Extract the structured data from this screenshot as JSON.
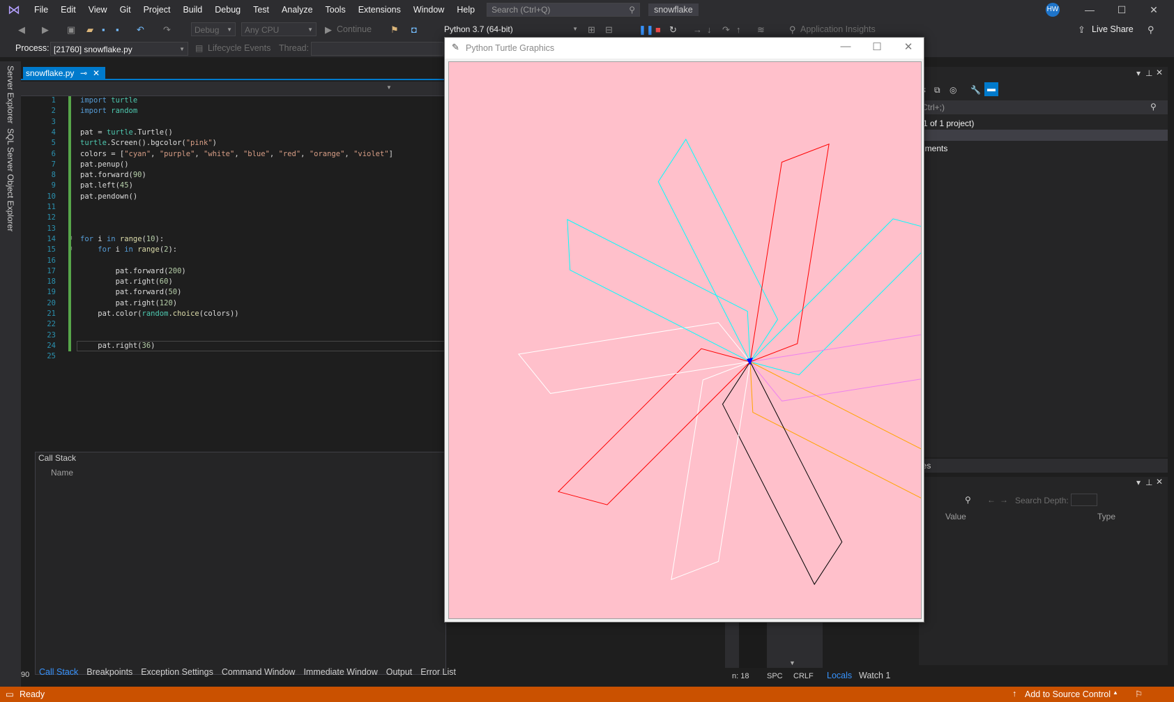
{
  "menubar": {
    "items": [
      "File",
      "Edit",
      "View",
      "Git",
      "Project",
      "Build",
      "Debug",
      "Test",
      "Analyze",
      "Tools",
      "Extensions",
      "Window",
      "Help"
    ],
    "search_placeholder": "Search (Ctrl+Q)",
    "solution_name": "snowflake",
    "user_initials": "HW"
  },
  "toolbar": {
    "config": "Debug",
    "platform": "Any CPU",
    "continue_label": "Continue",
    "python_env": "Python 3.7 (64-bit)",
    "app_insights": "Application Insights",
    "live_share": "Live Share"
  },
  "debugbar": {
    "process_label": "Process:",
    "process_value": "[21760] snowflake.py",
    "lifecycle_label": "Lifecycle Events",
    "thread_label": "Thread:"
  },
  "side_tabs": [
    "Server Explorer",
    "SQL Server Object Explorer"
  ],
  "editor": {
    "tab_name": "snowflake.py",
    "line_numbers": [
      "1",
      "2",
      "3",
      "4",
      "5",
      "6",
      "7",
      "8",
      "9",
      "10",
      "11",
      "12",
      "13",
      "14",
      "15",
      "16",
      "17",
      "18",
      "19",
      "20",
      "21",
      "22",
      "23",
      "24",
      "25"
    ],
    "lines": [
      "import turtle",
      "import random",
      "",
      "pat = turtle.Turtle()",
      "turtle.Screen().bgcolor(\"pink\")",
      "colors = [\"cyan\", \"purple\", \"white\", \"blue\", \"red\", \"orange\", \"violet\"]",
      "pat.penup()",
      "pat.forward(90)",
      "pat.left(45)",
      "pat.pendown()",
      "",
      "",
      "",
      "for i in range(10):",
      "    for i in range(2):",
      "",
      "        pat.forward(200)",
      "        pat.right(60)",
      "        pat.forward(50)",
      "        pat.right(120)",
      "    pat.color(random.choice(colors))",
      "",
      "",
      "    pat.right(36)",
      ""
    ],
    "zoom": "90"
  },
  "callstack": {
    "title": "Call Stack",
    "column_name": "Name"
  },
  "bottom_tabs": [
    "Call Stack",
    "Breakpoints",
    "Exception Settings",
    "Command Window",
    "Immediate Window",
    "Output",
    "Error List"
  ],
  "solution_panel": {
    "search_hint": "Ctrl+;)",
    "solution_line": "(1 of 1 project)",
    "env_line": "nments"
  },
  "properties_title": "ies",
  "locals": {
    "search_depth_label": "Search Depth:",
    "col_value": "Value",
    "col_type": "Type",
    "tabs": [
      "Locals",
      "Watch 1"
    ]
  },
  "status": {
    "ready": "Ready",
    "col": "n: 18",
    "spc": "SPC",
    "crlf": "CRLF",
    "source_control": "Add to Source Control"
  },
  "turtle_window": {
    "title": "Python Turtle Graphics",
    "bgcolor": "#ffc0cb",
    "petals": [
      {
        "color": "#00ffff",
        "heading": 45
      },
      {
        "color": "#ee82ee",
        "heading": 9
      },
      {
        "color": "#ffa500",
        "heading": -27
      },
      {
        "color": "#000000",
        "heading": -63
      },
      {
        "color": "#ffffff",
        "heading": -99
      },
      {
        "color": "#ff0000",
        "heading": -135
      },
      {
        "color": "#ffffff",
        "heading": -171
      },
      {
        "color": "#00ffff",
        "heading": -207
      },
      {
        "color": "#00ffff",
        "heading": -243
      },
      {
        "color": "#ff0000",
        "heading": -279
      }
    ]
  }
}
